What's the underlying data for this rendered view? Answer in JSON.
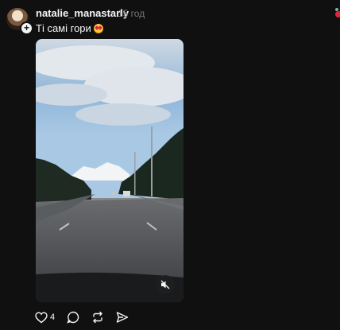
{
  "post": {
    "username": "natalie_manastarly",
    "time": "15 год",
    "caption": "Ті самі гори",
    "caption_emoji": "star-struck-emoji",
    "likes": "4"
  },
  "icons": {
    "add": "plus-icon",
    "mute": "speaker-muted-icon",
    "like": "heart-icon",
    "comment": "comment-icon",
    "repost": "repost-icon",
    "share": "send-icon"
  },
  "colors": {
    "background": "#101010",
    "text": "#f3f5f7",
    "muted": "#777777"
  }
}
